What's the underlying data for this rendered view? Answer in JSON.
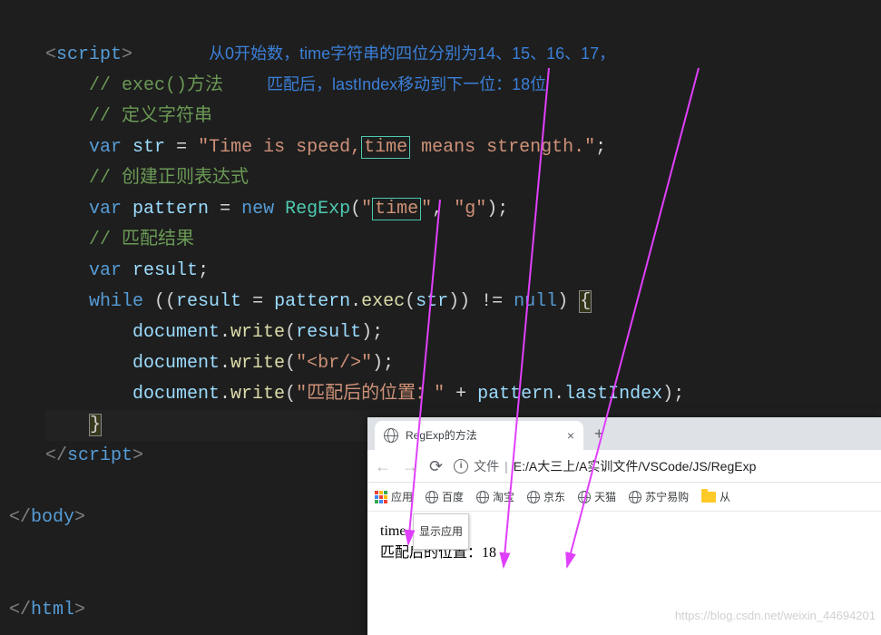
{
  "annotation": {
    "line1": "从0开始数，time字符串的四位分别为14、15、16、17，",
    "line2": "匹配后，lastIndex移动到下一位：18位"
  },
  "code": {
    "open_script": "script",
    "c1": "// exec()方法",
    "c2": "// 定义字符串",
    "kw_var1": "var",
    "v_str": "str",
    "eq": " = ",
    "s_str_a": "\"Time is speed,",
    "s_str_time": "time",
    "s_str_b": " means strength.\"",
    "semi": ";",
    "c3": "// 创建正则表达式",
    "kw_var2": "var",
    "v_pattern": "pattern",
    "kw_new": "new",
    "cls_regexp": "RegExp",
    "s_arg1_q": "\"",
    "s_arg1": "time",
    "s_arg1_q2": "\"",
    "s_arg2": "\"g\"",
    "c4": "// 匹配结果",
    "kw_var3": "var",
    "v_result": "result",
    "kw_while": "while",
    "fn_exec": "exec",
    "kw_null": "null",
    "v_document": "document",
    "fn_write": "write",
    "s_br": "\"<br/>\"",
    "s_match": "\"匹配后的位置：\"",
    "v_lastIndex": "lastIndex",
    "close_script": "script",
    "close_body": "body",
    "close_html": "html"
  },
  "browser": {
    "tab_title": "RegExp的方法",
    "url_prefix": "文件",
    "url": "E:/A大三上/A实训文件/VSCode/JS/RegExp",
    "tooltip": "显示应用",
    "bookmarks": {
      "apps": "应用",
      "baidu": "百度",
      "taobao": "淘宝",
      "jd": "京东",
      "tmall": "天猫",
      "suning": "苏宁易购",
      "folder": "从"
    },
    "output_line1": "time",
    "output_line2": "匹配后的位置：18"
  },
  "watermark": "https://blog.csdn.net/weixin_44694201"
}
